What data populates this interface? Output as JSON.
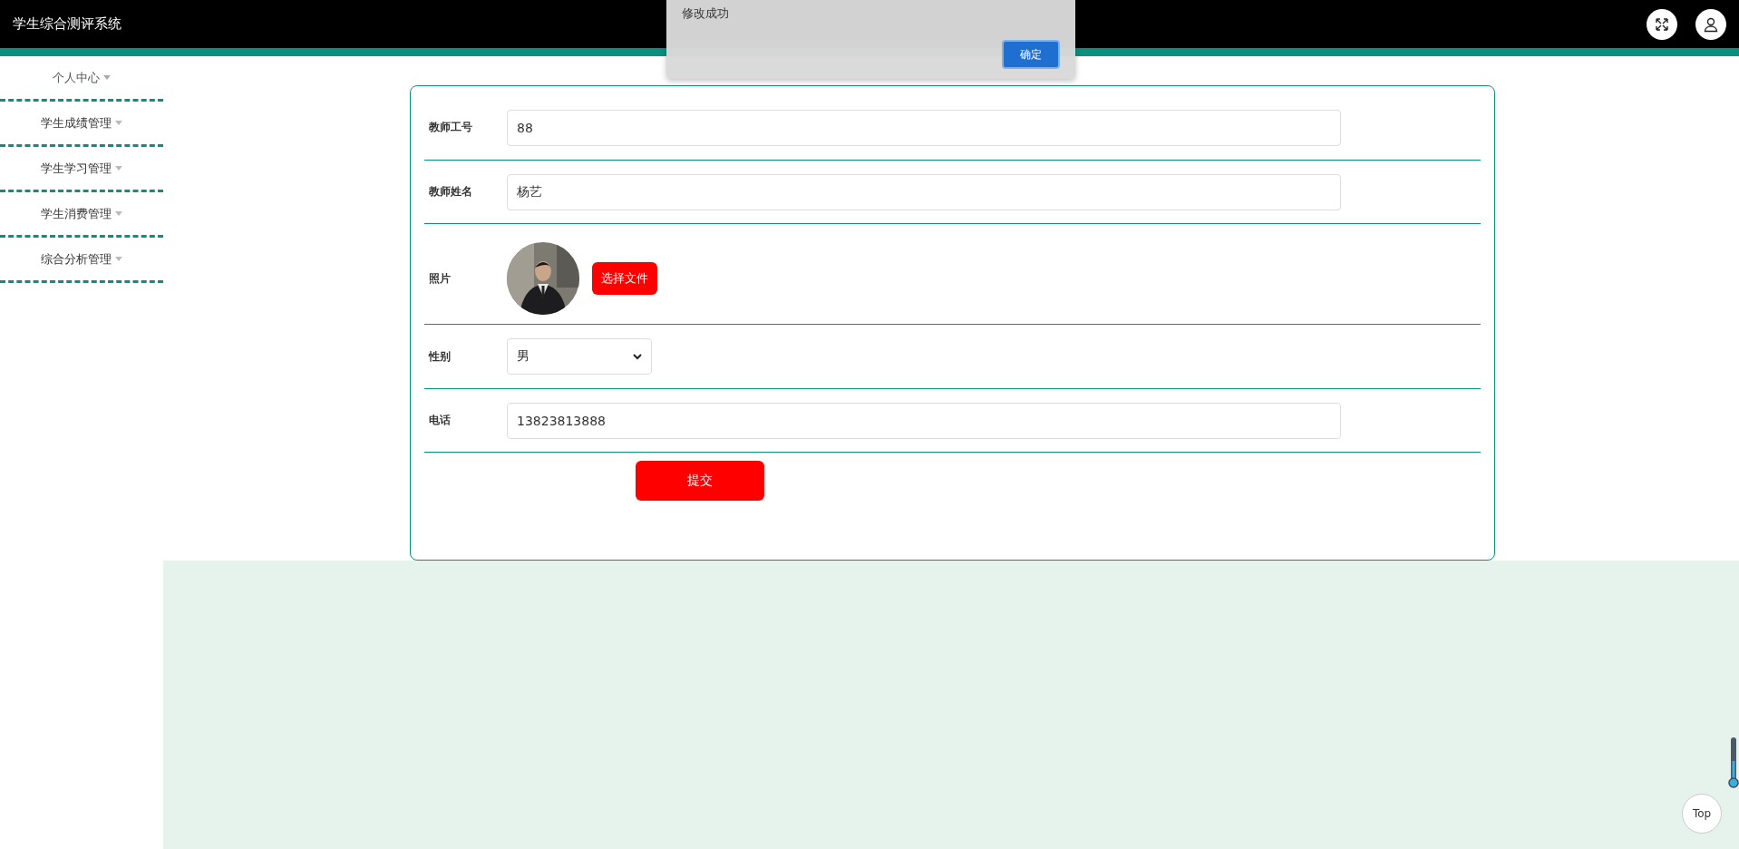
{
  "header": {
    "title": "学生综合测评系统"
  },
  "sidebar": {
    "items": [
      {
        "label": "个人中心",
        "selected": true
      },
      {
        "label": "学生成绩管理",
        "selected": false
      },
      {
        "label": "学生学习管理",
        "selected": false
      },
      {
        "label": "学生消费管理",
        "selected": false
      },
      {
        "label": "综合分析管理",
        "selected": false
      }
    ]
  },
  "form": {
    "fields": [
      {
        "kind": "text",
        "label": "教师工号",
        "value": "88"
      },
      {
        "kind": "text",
        "label": "教师姓名",
        "value": "杨艺"
      },
      {
        "label": "照片",
        "button": "选择文件"
      },
      {
        "kind": "select",
        "label": "性别",
        "value": "男"
      },
      {
        "kind": "text",
        "label": "电话",
        "value": "13823813888"
      }
    ],
    "submit": "提交"
  },
  "dialog": {
    "message": "修改成功",
    "button": "确定"
  },
  "back_to_top": "Top"
}
